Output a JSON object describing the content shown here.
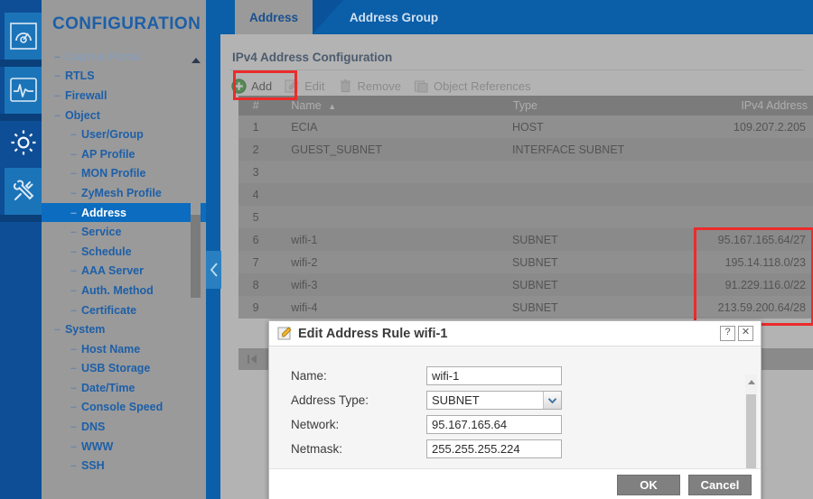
{
  "rail": {
    "icons": [
      {
        "name": "dashboard-icon",
        "label": "Dashboard"
      },
      {
        "name": "monitor-icon",
        "label": "Monitor"
      },
      {
        "name": "configuration-gear-icon",
        "label": "Configuration"
      },
      {
        "name": "maintenance-tools-icon",
        "label": "Maintenance"
      }
    ]
  },
  "sidebar": {
    "title": "CONFIGURATION",
    "items": [
      {
        "label": "Captive Portal",
        "level": 1,
        "cut": true,
        "active": false
      },
      {
        "label": "RTLS",
        "level": 1,
        "cut": false,
        "active": false
      },
      {
        "label": "Firewall",
        "level": 1,
        "cut": false,
        "active": false
      },
      {
        "label": "Object",
        "level": 1,
        "cut": false,
        "active": false,
        "expanded": true
      },
      {
        "label": "User/Group",
        "level": 2,
        "cut": false,
        "active": false
      },
      {
        "label": "AP Profile",
        "level": 2,
        "cut": false,
        "active": false
      },
      {
        "label": "MON Profile",
        "level": 2,
        "cut": false,
        "active": false
      },
      {
        "label": "ZyMesh Profile",
        "level": 2,
        "cut": false,
        "active": false
      },
      {
        "label": "Address",
        "level": 2,
        "cut": false,
        "active": true
      },
      {
        "label": "Service",
        "level": 2,
        "cut": false,
        "active": false
      },
      {
        "label": "Schedule",
        "level": 2,
        "cut": false,
        "active": false
      },
      {
        "label": "AAA Server",
        "level": 2,
        "cut": false,
        "active": false
      },
      {
        "label": "Auth. Method",
        "level": 2,
        "cut": false,
        "active": false
      },
      {
        "label": "Certificate",
        "level": 2,
        "cut": false,
        "active": false
      },
      {
        "label": "System",
        "level": 1,
        "cut": false,
        "active": false,
        "expanded": true
      },
      {
        "label": "Host Name",
        "level": 2,
        "cut": false,
        "active": false
      },
      {
        "label": "USB Storage",
        "level": 2,
        "cut": false,
        "active": false
      },
      {
        "label": "Date/Time",
        "level": 2,
        "cut": false,
        "active": false
      },
      {
        "label": "Console Speed",
        "level": 2,
        "cut": false,
        "active": false
      },
      {
        "label": "DNS",
        "level": 2,
        "cut": false,
        "active": false
      },
      {
        "label": "WWW",
        "level": 2,
        "cut": false,
        "active": false
      },
      {
        "label": "SSH",
        "level": 2,
        "cut": false,
        "active": false
      }
    ]
  },
  "tabs": [
    {
      "label": "Address",
      "selected": true
    },
    {
      "label": "Address Group",
      "selected": false
    }
  ],
  "panel": {
    "title": "IPv4 Address Configuration",
    "toolbar": [
      {
        "label": "Add",
        "icon": "plus-circle-icon",
        "enabled": true,
        "highlighted": true
      },
      {
        "label": "Edit",
        "icon": "edit-pencil-icon",
        "enabled": false,
        "highlighted": false
      },
      {
        "label": "Remove",
        "icon": "trash-icon",
        "enabled": false,
        "highlighted": false
      },
      {
        "label": "Object References",
        "icon": "references-icon",
        "enabled": false,
        "highlighted": false
      }
    ]
  },
  "table": {
    "columns": [
      "#",
      "Name",
      "Type",
      "IPv4 Address"
    ],
    "sort_column": "Name",
    "sort_direction": "ascending",
    "rows": [
      {
        "num": "1",
        "name": "ECIA",
        "type": "HOST",
        "ipv4": "109.207.2.205"
      },
      {
        "num": "2",
        "name": "GUEST_SUBNET",
        "type": "INTERFACE SUBNET",
        "ipv4": ""
      },
      {
        "num": "3",
        "name": "",
        "type": "",
        "ipv4": ""
      },
      {
        "num": "4",
        "name": "",
        "type": "",
        "ipv4": ""
      },
      {
        "num": "5",
        "name": "",
        "type": "",
        "ipv4": ""
      },
      {
        "num": "6",
        "name": "wifi-1",
        "type": "SUBNET",
        "ipv4": "95.167.165.64/27"
      },
      {
        "num": "7",
        "name": "wifi-2",
        "type": "SUBNET",
        "ipv4": "195.14.118.0/23"
      },
      {
        "num": "8",
        "name": "wifi-3",
        "type": "SUBNET",
        "ipv4": "91.229.116.0/22"
      },
      {
        "num": "9",
        "name": "wifi-4",
        "type": "SUBNET",
        "ipv4": "213.59.200.64/28"
      }
    ]
  },
  "dialog": {
    "title": "Edit Address Rule wifi-1",
    "icon": "edit-pencil-icon",
    "help_label": "?",
    "close_label": "✕",
    "fields": [
      {
        "label": "Name:",
        "value": "wifi-1",
        "kind": "text"
      },
      {
        "label": "Address Type:",
        "value": "SUBNET",
        "kind": "select"
      },
      {
        "label": "Network:",
        "value": "95.167.165.64",
        "kind": "text"
      },
      {
        "label": "Netmask:",
        "value": "255.255.255.224",
        "kind": "text"
      }
    ],
    "ok_label": "OK",
    "cancel_label": "Cancel"
  },
  "highlights": {
    "color": "#ec2b2b",
    "regions": [
      "add-button",
      "ipv4-address-column"
    ]
  }
}
